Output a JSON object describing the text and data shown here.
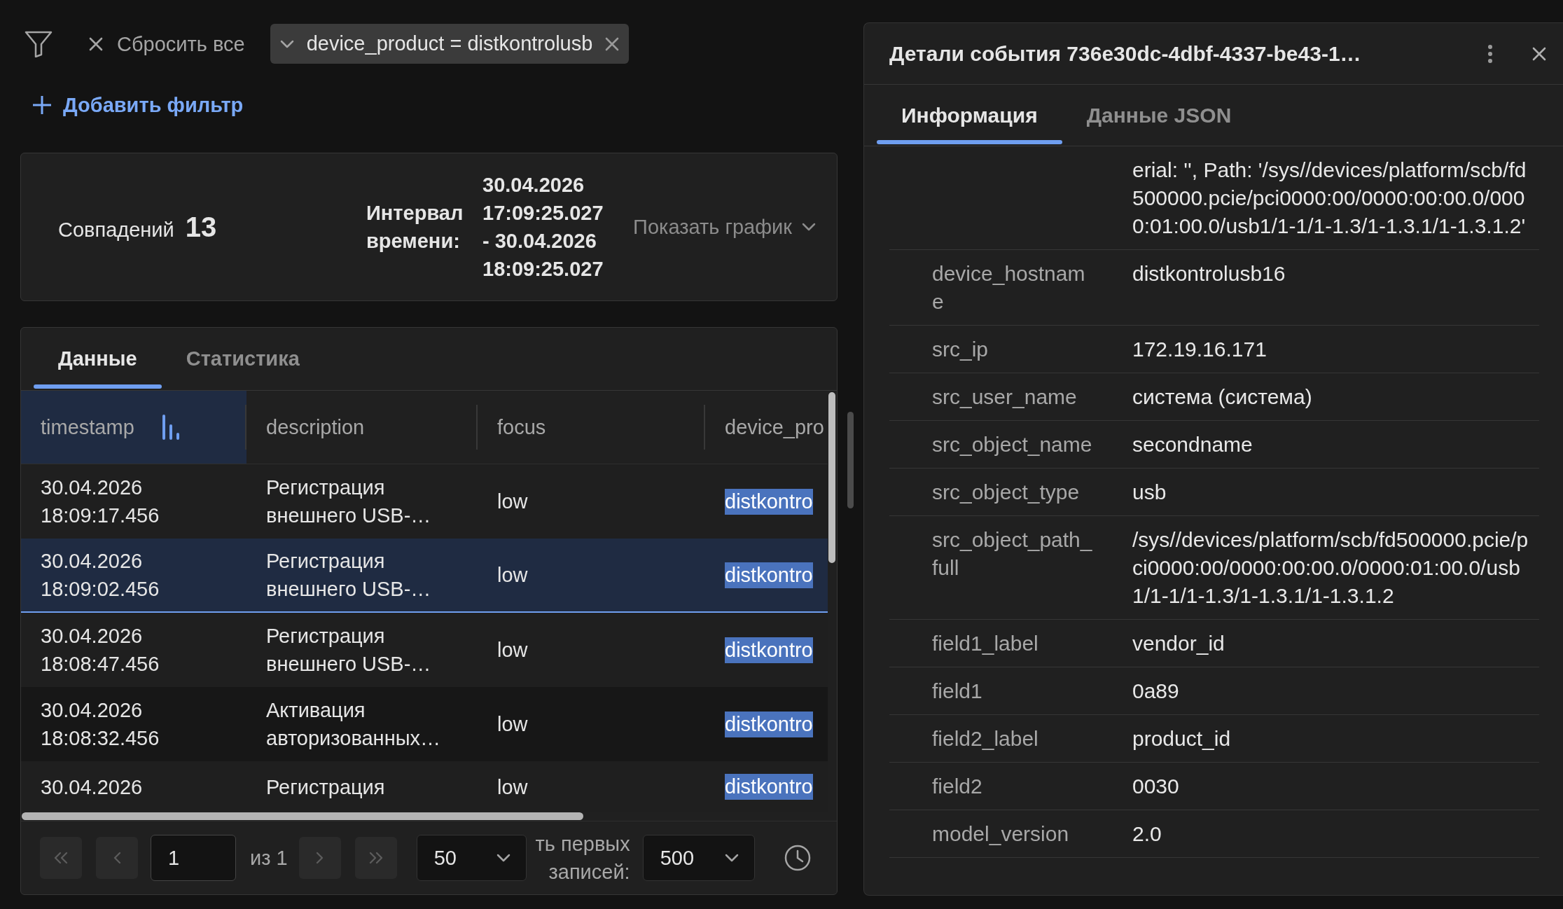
{
  "filter_bar": {
    "reset_all": {
      "label": "Сбросить все"
    },
    "chips": [
      {
        "label": "device_product = distkontrolusb"
      }
    ],
    "add_filter": {
      "label": "Добавить фильтр"
    }
  },
  "summary": {
    "matches_label": "Совпадений",
    "matches_count": "13",
    "interval_label": "Интервал времени:",
    "interval_value": "30.04.2026 17:09:25.027 - 30.04.2026 18:09:25.027",
    "show_chart": {
      "label": "Показать график",
      "expanded": false
    }
  },
  "data_card": {
    "tabs": [
      {
        "label": "Данные",
        "selected": true
      },
      {
        "label": "Статистика",
        "selected": false
      }
    ],
    "table": {
      "columns": [
        {
          "label": "timestamp",
          "sorted": true
        },
        {
          "label": "description",
          "sorted": false
        },
        {
          "label": "focus",
          "sorted": false
        },
        {
          "label": "device_pro",
          "sorted": false
        }
      ],
      "rows": [
        {
          "selected": false,
          "cells": [
            {
              "text": "30.04.2026 18:09:17.456",
              "highlighted": false
            },
            {
              "text": "Регистрация внешнего USB-…",
              "highlighted": false
            },
            {
              "text": "low",
              "highlighted": false
            },
            {
              "text": "distkontro",
              "highlighted": true
            }
          ]
        },
        {
          "selected": true,
          "cells": [
            {
              "text": "30.04.2026 18:09:02.456",
              "highlighted": false
            },
            {
              "text": "Регистрация внешнего USB-…",
              "highlighted": false
            },
            {
              "text": "low",
              "highlighted": false
            },
            {
              "text": "distkontro",
              "highlighted": true
            }
          ]
        },
        {
          "selected": false,
          "cells": [
            {
              "text": "30.04.2026 18:08:47.456",
              "highlighted": false
            },
            {
              "text": "Регистрация внешнего USB-…",
              "highlighted": false
            },
            {
              "text": "low",
              "highlighted": false
            },
            {
              "text": "distkontro",
              "highlighted": true
            }
          ]
        },
        {
          "selected": false,
          "cells": [
            {
              "text": "30.04.2026 18:08:32.456",
              "highlighted": false
            },
            {
              "text": "Активация авторизованных…",
              "highlighted": false
            },
            {
              "text": "low",
              "highlighted": false
            },
            {
              "text": "distkontro",
              "highlighted": true
            }
          ]
        },
        {
          "selected": false,
          "cells": [
            {
              "text": "30.04.2026",
              "highlighted": false
            },
            {
              "text": "Регистрация",
              "highlighted": false
            },
            {
              "text": "low",
              "highlighted": false
            },
            {
              "text": "distkontro",
              "highlighted": true
            }
          ]
        }
      ]
    },
    "pagination": {
      "first": {
        "disabled": true
      },
      "previous": {
        "disabled": true
      },
      "page": "1",
      "page_count": "из 1",
      "next": {
        "disabled": true
      },
      "last": {
        "disabled": true
      },
      "page_size": "50",
      "limit_label": "ть первых записей:",
      "limit": "500"
    }
  },
  "details": {
    "title": "Детали события 736e30dc-4dbf-4337-be43-1…",
    "tabs": [
      {
        "label": "Информация",
        "selected": true
      },
      {
        "label": "Данные JSON",
        "selected": false
      }
    ],
    "fields": [
      {
        "value": "erial: '', Path: '/sys//devices/platform/scb/fd500000.pcie/pci0000:00/0000:00:00.0/0000:01:00.0/usb1/1-1/1-1.3/1-1.3.1/1-1.3.1.2'"
      },
      {
        "key": "device_hostname",
        "value": "distkontrolusb16"
      },
      {
        "key": "src_ip",
        "value": "172.19.16.171"
      },
      {
        "key": "src_user_name",
        "value": "система (система)"
      },
      {
        "key": "src_object_name",
        "value": "secondname"
      },
      {
        "key": "src_object_type",
        "value": "usb"
      },
      {
        "key": "src_object_path_full",
        "value": "/sys//devices/platform/scb/fd500000.pcie/pci0000:00/0000:00:00.0/0000:01:00.0/usb1/1-1/1-1.3/1-1.3.1/1-1.3.1.2"
      },
      {
        "key": "field1_label",
        "value": "vendor_id"
      },
      {
        "key": "field1",
        "value": "0a89"
      },
      {
        "key": "field2_label",
        "value": "product_id"
      },
      {
        "key": "field2",
        "value": "0030"
      },
      {
        "key": "model_version",
        "value": "2.0"
      }
    ]
  }
}
